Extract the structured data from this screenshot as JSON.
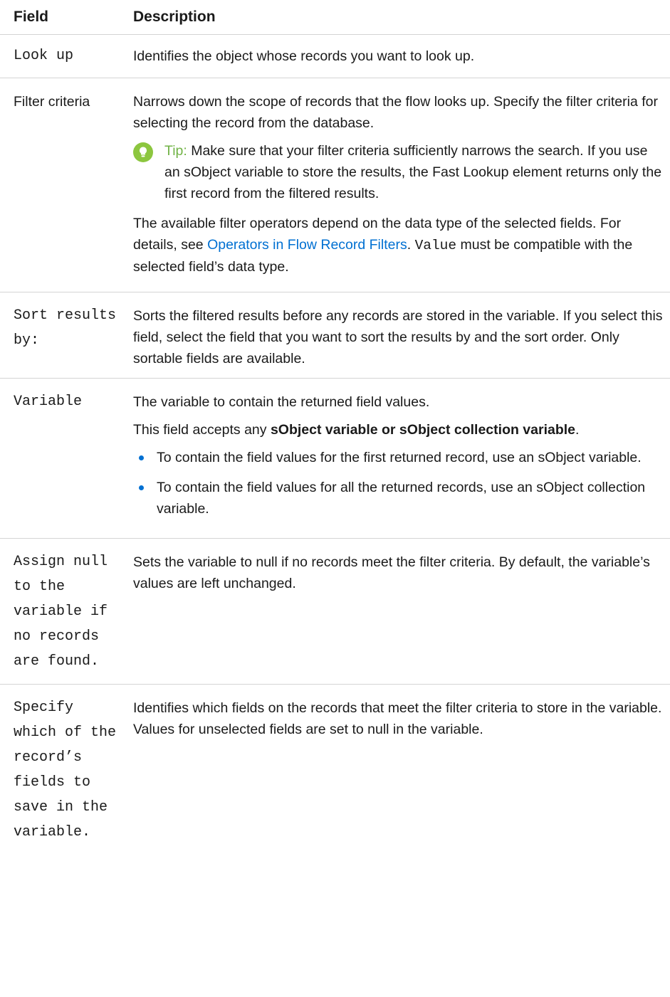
{
  "header": {
    "field": "Field",
    "description": "Description"
  },
  "rows": [
    {
      "field": "Look up",
      "description": "Identifies the object whose records you want to look up."
    },
    {
      "field": "Filter criteria",
      "p1": "Narrows down the scope of records that the flow looks up. Specify the filter criteria for selecting the record from the database.",
      "tip_label": "Tip:",
      "tip_text": "Make sure that your filter criteria sufficiently narrows the search. If you use an sObject variable to store the results, the Fast Lookup element returns only the first record from the filtered results.",
      "p3_before": "The available filter operators depend on the data type of the selected fields. For details, see ",
      "p3_link": "Operators in Flow Record Filters",
      "p3_mid": ". ",
      "p3_code": "Value",
      "p3_after": " must be compatible with the selected field’s data type."
    },
    {
      "field": "Sort results by:",
      "description": "Sorts the filtered results before any records are stored in the variable. If you select this field, select the field that you want to sort the results by and the sort order. Only sortable fields are available."
    },
    {
      "field": "Variable",
      "p1": "The variable to contain the returned field values.",
      "p2_before": "This field accepts any ",
      "p2_bold": "sObject variable or sObject collection variable",
      "p2_after": ".",
      "bullets": [
        "To contain the field values for the first returned record, use an sObject variable.",
        "To contain the field values for all the returned records, use an sObject collection variable."
      ]
    },
    {
      "field": "Assign null to the variable if no records are found.",
      "description": "Sets the variable to null if no records meet the filter criteria. By default, the variable’s values are left unchanged."
    },
    {
      "field": "Specify which of the record’s fields to save in the variable.",
      "description": "Identifies which fields on the records that meet the filter criteria to store in the variable. Values for unselected fields are set to null in the variable."
    }
  ],
  "colors": {
    "link": "#0070d2",
    "tip_icon": "#8cc63f",
    "tip_label": "#71b346",
    "bullet": "#0070d2",
    "rule": "#d4d4d4"
  },
  "icons": {
    "tip": "lightbulb-icon",
    "bullet": "bullet-dot-icon"
  }
}
